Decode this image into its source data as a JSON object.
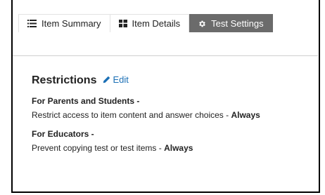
{
  "tabs": [
    {
      "label": "Item Summary",
      "icon": "list-icon",
      "active": false
    },
    {
      "label": "Item Details",
      "icon": "grid-icon",
      "active": false
    },
    {
      "label": "Test Settings",
      "icon": "gear-icon",
      "active": true
    }
  ],
  "restrictions": {
    "title": "Restrictions",
    "edit_label": "Edit",
    "edit_icon": "pencil-icon",
    "link_color": "#1a6fb5",
    "groups": [
      {
        "title": "For Parents and Students -",
        "text": "Restrict access to item content and answer choices - ",
        "value": "Always"
      },
      {
        "title": "For Educators -",
        "text": "Prevent copying test or test items - ",
        "value": "Always"
      }
    ]
  },
  "colors": {
    "active_tab_bg": "#6b6b6b",
    "text": "#222222"
  }
}
